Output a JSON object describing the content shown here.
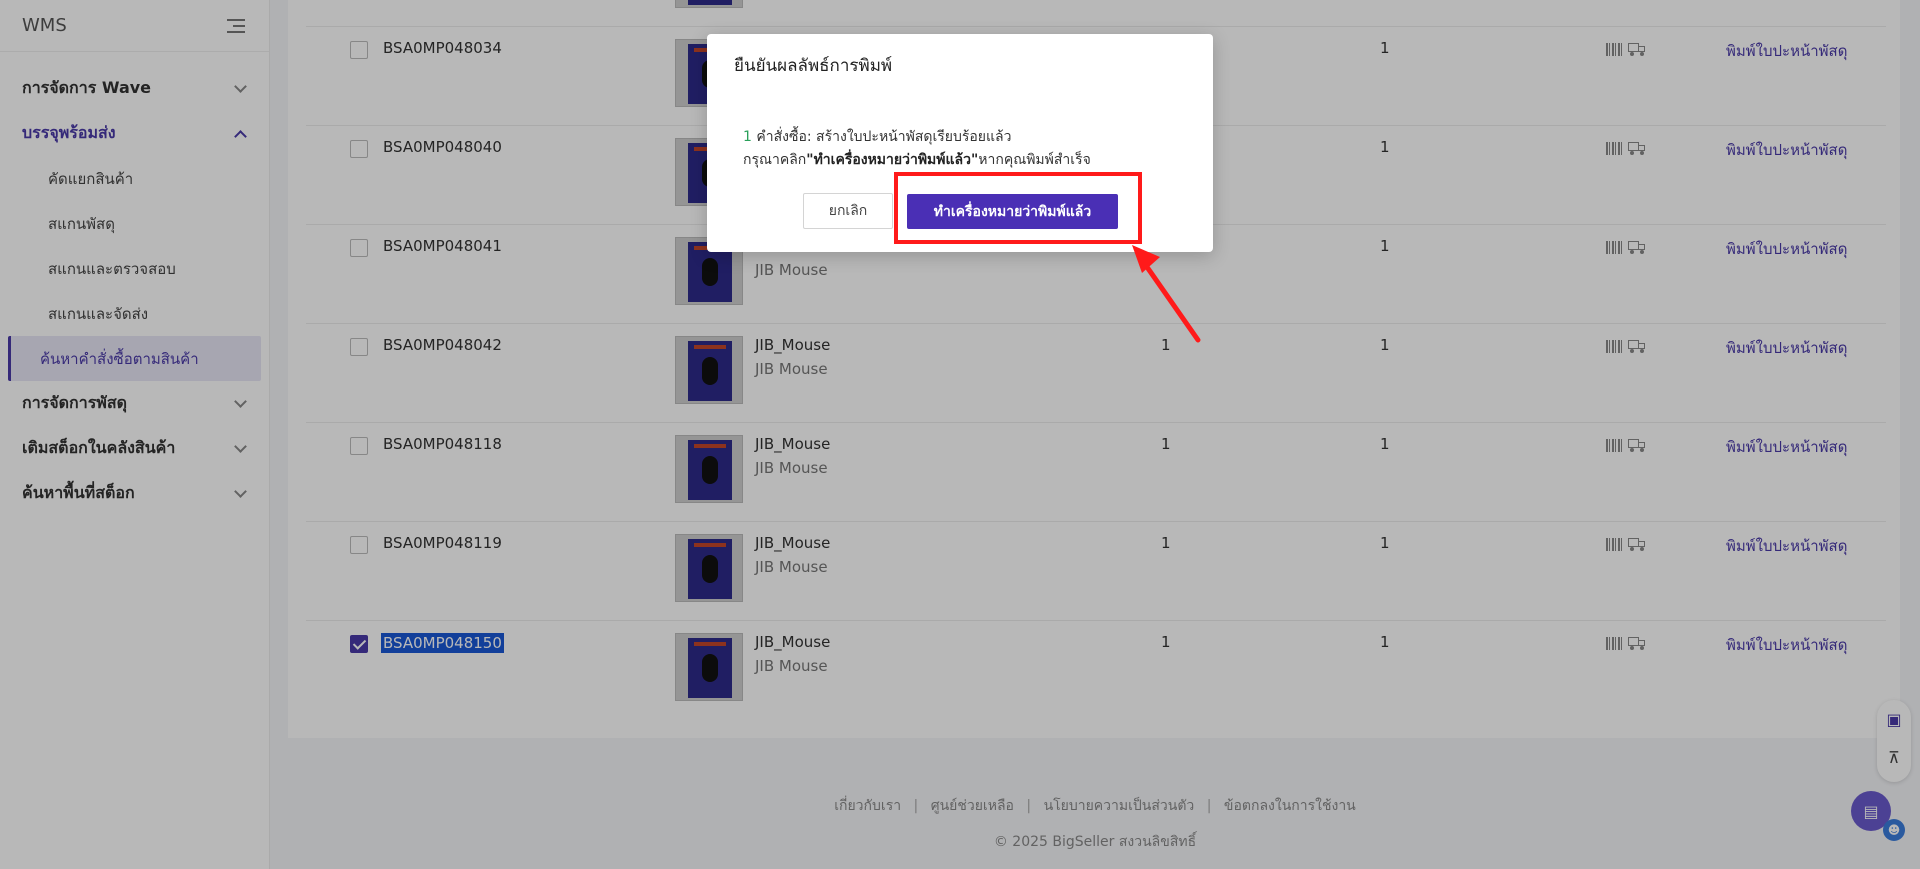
{
  "sidebar": {
    "brand": "WMS",
    "collapse_icon": "menu-collapse-icon",
    "groups": [
      {
        "label": "การจัดการ Wave",
        "expanded": false
      },
      {
        "label": "บรรจุพร้อมส่ง",
        "expanded": true,
        "items": [
          {
            "label": "คัดแยกสินค้า"
          },
          {
            "label": "สแกนพัสดุ"
          },
          {
            "label": "สแกนและตรวจสอบ"
          },
          {
            "label": "สแกนและจัดส่ง"
          },
          {
            "label": "ค้นหาคำสั่งซื้อตามสินค้า",
            "active": true
          }
        ]
      },
      {
        "label": "การจัดการพัสดุ",
        "expanded": false
      },
      {
        "label": "เติมสต็อกในคลังสินค้า",
        "expanded": false
      },
      {
        "label": "ค้นหาพื้นที่สต็อก",
        "expanded": false
      }
    ]
  },
  "rows": [
    {
      "order": "BSA0MP048034",
      "product": "",
      "variant": "",
      "qty1": "",
      "qty2": "1",
      "action": "พิมพ์ใบปะหน้าพัสดุ",
      "checked": false
    },
    {
      "order": "BSA0MP048040",
      "product": "",
      "variant": "",
      "qty1": "",
      "qty2": "1",
      "action": "พิมพ์ใบปะหน้าพัสดุ",
      "checked": false
    },
    {
      "order": "BSA0MP048041",
      "product": "",
      "variant": "JIB Mouse",
      "qty1": "",
      "qty2": "1",
      "action": "พิมพ์ใบปะหน้าพัสดุ",
      "checked": false
    },
    {
      "order": "BSA0MP048042",
      "product": "JIB_Mouse",
      "variant": "JIB Mouse",
      "qty1": "1",
      "qty2": "1",
      "action": "พิมพ์ใบปะหน้าพัสดุ",
      "checked": false
    },
    {
      "order": "BSA0MP048118",
      "product": "JIB_Mouse",
      "variant": "JIB Mouse",
      "qty1": "1",
      "qty2": "1",
      "action": "พิมพ์ใบปะหน้าพัสดุ",
      "checked": false
    },
    {
      "order": "BSA0MP048119",
      "product": "JIB_Mouse",
      "variant": "JIB Mouse",
      "qty1": "1",
      "qty2": "1",
      "action": "พิมพ์ใบปะหน้าพัสดุ",
      "checked": false
    },
    {
      "order": "BSA0MP048150",
      "product": "JIB_Mouse",
      "variant": "JIB Mouse",
      "qty1": "1",
      "qty2": "1",
      "action": "พิมพ์ใบปะหน้าพัสดุ",
      "checked": true
    }
  ],
  "footer": {
    "links": [
      "เกี่ยวกับเรา",
      "ศูนย์ช่วยเหลือ",
      "นโยบายความเป็นส่วนตัว",
      "ข้อตกลงในการใช้งาน"
    ],
    "separator": "|",
    "copyright": "© 2025 BigSeller สงวนลิขสิทธิ์"
  },
  "modal": {
    "title": "ยืนยันผลลัพธ์การพิมพ์",
    "count": "1",
    "line1_rest": " คำสั่งซื้อ: สร้างใบปะหน้าพัสดุเรียบร้อยแล้ว",
    "line2_prefix": "กรุณาคลิก",
    "line2_bold": "\"ทำเครื่องหมายว่าพิมพ์แล้ว\"",
    "line2_suffix": "หากคุณพิมพ์สำเร็จ",
    "cancel_label": "ยกเลิก",
    "confirm_label": "ทำเครื่องหมายว่าพิมพ์แล้ว"
  },
  "colors": {
    "accent": "#4a3aa8",
    "confirm_button": "#4a2fb5",
    "annotation": "#ff1a1a",
    "success_number": "#2aa05a"
  },
  "icons": {
    "barcode": "barcode-icon",
    "truck": "truck-icon",
    "support": "support-icon",
    "back_to_top": "back-to-top-icon",
    "chat": "chat-icon",
    "robot": "robot-icon"
  }
}
